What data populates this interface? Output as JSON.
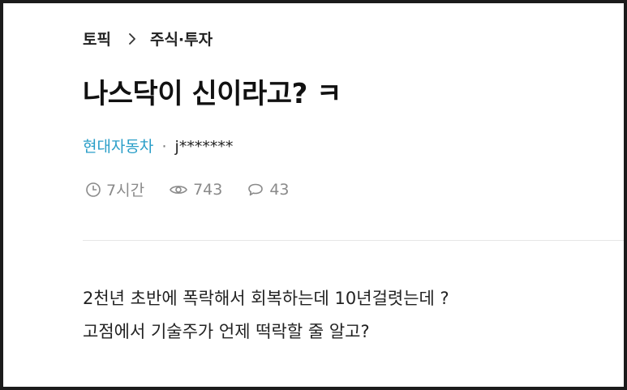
{
  "breadcrumb": {
    "root": "토픽",
    "current": "주식·투자"
  },
  "post": {
    "title": "나스닥이 신이라고? ㅋ",
    "company": "현대자동차",
    "separator": "·",
    "author": "j*******",
    "time": "7시간",
    "views": "743",
    "comments": "43",
    "body_lines": [
      "2천년 초반에 폭락해서 회복하는데 10년걸렷는데 ?",
      "고점에서 기술주가 언제 떡락할 줄 알고?"
    ]
  },
  "colors": {
    "company": "#2a9ec8",
    "meta": "#8a8a8a",
    "text": "#222222",
    "divider": "#e6e6e6"
  },
  "icons": [
    "chevron-right-icon",
    "clock-icon",
    "eye-icon",
    "comment-icon"
  ]
}
